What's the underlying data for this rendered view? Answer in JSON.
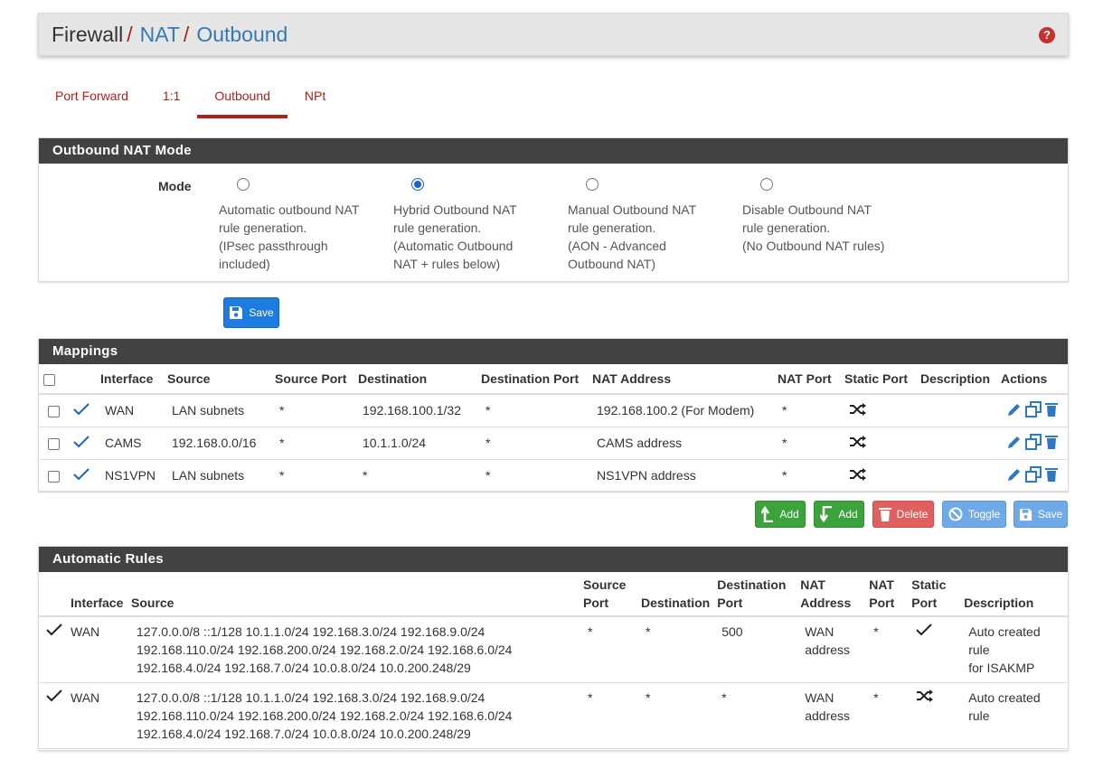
{
  "breadcrumb": {
    "root": "Firewall",
    "sep": "/",
    "level1": "NAT",
    "level2": "Outbound"
  },
  "help_label": "?",
  "tabs": [
    {
      "label": "Port Forward"
    },
    {
      "label": "1:1"
    },
    {
      "label": "Outbound"
    },
    {
      "label": "NPt"
    }
  ],
  "mode_panel": {
    "title": "Outbound NAT Mode",
    "label": "Mode",
    "options": [
      {
        "lines": [
          "Automatic outbound NAT",
          "rule generation.",
          "(IPsec passthrough",
          "included)"
        ]
      },
      {
        "lines": [
          "Hybrid Outbound NAT",
          "rule generation.",
          "(Automatic Outbound",
          "NAT + rules below)"
        ]
      },
      {
        "lines": [
          "Manual Outbound NAT",
          "rule generation.",
          "(AON - Advanced",
          "Outbound NAT)"
        ]
      },
      {
        "lines": [
          "Disable Outbound NAT",
          "rule generation.",
          "(No Outbound NAT rules)"
        ]
      }
    ],
    "selected_index": 1,
    "save_label": "Save"
  },
  "mappings": {
    "title": "Mappings",
    "columns": [
      "Interface",
      "Source",
      "Source Port",
      "Destination",
      "Destination Port",
      "NAT Address",
      "NAT Port",
      "Static Port",
      "Description",
      "Actions"
    ],
    "rows": [
      {
        "interface": "WAN",
        "source": "LAN subnets",
        "source_port": "*",
        "destination": "192.168.100.1/32",
        "destination_port": "*",
        "nat_address": "192.168.100.2 (For Modem)",
        "nat_port": "*",
        "description": ""
      },
      {
        "interface": "CAMS",
        "source": "192.168.0.0/16",
        "source_port": "*",
        "destination": "10.1.1.0/24",
        "destination_port": "*",
        "nat_address": "CAMS address",
        "nat_port": "*",
        "description": ""
      },
      {
        "interface": "NS1VPN",
        "source": "LAN subnets",
        "source_port": "*",
        "destination": "*",
        "destination_port": "*",
        "nat_address": "NS1VPN address",
        "nat_port": "*",
        "description": ""
      }
    ],
    "buttons": {
      "add_top": "Add",
      "add_bottom": "Add",
      "delete": "Delete",
      "toggle": "Toggle",
      "save": "Save"
    }
  },
  "automatic_rules": {
    "title": "Automatic Rules",
    "columns": {
      "interface": "Interface",
      "source": "Source",
      "source_port": [
        "Source",
        "Port"
      ],
      "destination": "Destination",
      "destination_port": [
        "Destination",
        "Port"
      ],
      "nat_address": [
        "NAT",
        "Address"
      ],
      "nat_port": [
        "NAT",
        "Port"
      ],
      "static_port": [
        "Static",
        "Port"
      ],
      "description": "Description"
    },
    "rows": [
      {
        "interface": "WAN",
        "source_lines": [
          "127.0.0.0/8 ::1/128 10.1.1.0/24 192.168.3.0/24 192.168.9.0/24",
          "192.168.110.0/24 192.168.200.0/24 192.168.2.0/24 192.168.6.0/24",
          "192.168.4.0/24 192.168.7.0/24 10.0.8.0/24 10.0.200.248/29"
        ],
        "source_port": "*",
        "destination": "*",
        "destination_port": "500",
        "nat_address_lines": [
          "WAN",
          "address"
        ],
        "nat_port": "*",
        "static_icon": "check-icon",
        "description_lines": [
          "Auto created rule",
          "for ISAKMP"
        ]
      },
      {
        "interface": "WAN",
        "source_lines": [
          "127.0.0.0/8 ::1/128 10.1.1.0/24 192.168.3.0/24 192.168.9.0/24",
          "192.168.110.0/24 192.168.200.0/24 192.168.2.0/24 192.168.6.0/24",
          "192.168.4.0/24 192.168.7.0/24 10.0.8.0/24 10.0.200.248/29"
        ],
        "source_port": "*",
        "destination": "*",
        "destination_port": "*",
        "nat_address_lines": [
          "WAN",
          "address"
        ],
        "nat_port": "*",
        "static_icon": "shuffle-icon",
        "description_lines": [
          "Auto created rule"
        ]
      }
    ]
  },
  "colors": {
    "brand_red": "#b2201a",
    "link_blue": "#337ab7",
    "heading_dark": "#424242"
  }
}
